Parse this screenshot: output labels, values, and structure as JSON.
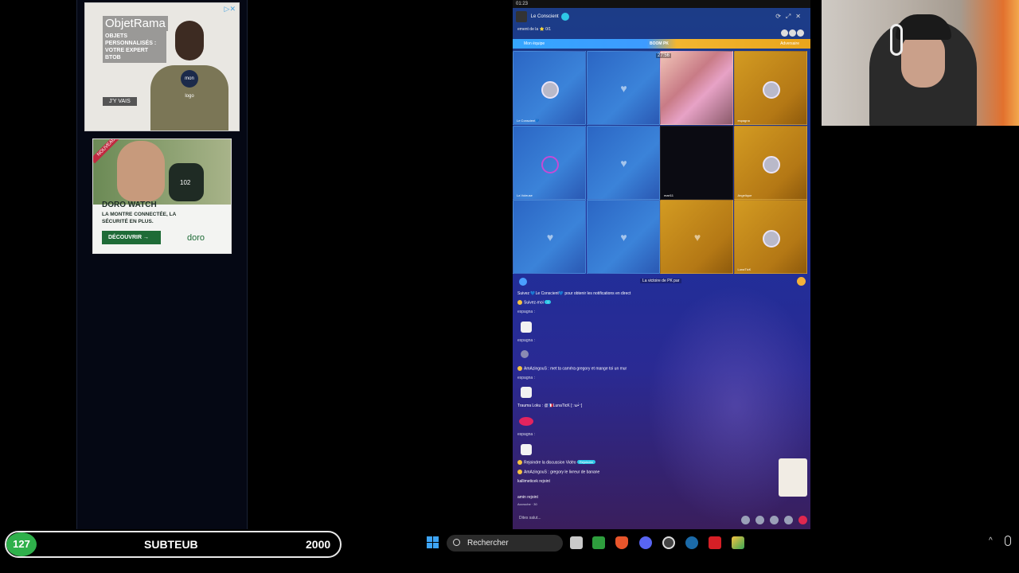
{
  "ads": {
    "objetrama": {
      "brand": "ObjetRama",
      "tagline": "OBJETS PERSONNALISÉS : VOTRE EXPERT BTOB",
      "cta": "J'Y VAIS",
      "logo_text": "mon logo"
    },
    "doro": {
      "badge": "NOUVEAU",
      "watch_value": "102",
      "title": "DORO WATCH",
      "subtitle": "LA MONTRE CONNECTÉE, LA SÉCURITÉ EN PLUS.",
      "cta": "DÉCOUVRIR →",
      "brand": "doro"
    }
  },
  "live": {
    "clock": "01:23",
    "host_name": "Le Conscient",
    "rank_text": "ement de la  ⭐ 0/1",
    "pk_left": "Mon équipe",
    "pk_center": "BOOM PK",
    "pk_right": "Adversaire",
    "timer": "27:56",
    "cells": [
      {
        "type": "blue",
        "kind": "avatar",
        "label": "Le Conscient💙"
      },
      {
        "type": "blue",
        "kind": "heart",
        "label": ""
      },
      {
        "type": "video",
        "kind": "video",
        "label": ""
      },
      {
        "type": "gold",
        "kind": "avatar",
        "label": "espagna"
      },
      {
        "type": "blue",
        "kind": "ring",
        "label": "La Voleuse"
      },
      {
        "type": "blue",
        "kind": "heart",
        "label": ""
      },
      {
        "type": "dark",
        "kind": "dark",
        "label": "mari11"
      },
      {
        "type": "gold",
        "kind": "avatar",
        "label": "Angelique"
      },
      {
        "type": "blue",
        "kind": "heart",
        "label": ""
      },
      {
        "type": "blue",
        "kind": "heart",
        "label": ""
      },
      {
        "type": "gold",
        "kind": "heart",
        "label": ""
      },
      {
        "type": "gold",
        "kind": "avatar",
        "label": "LunaTicK"
      }
    ],
    "pk_victory": "La victoire de PK par",
    "chat": {
      "follow_prompt": "Suivez 💙Le Conscient💙 pour obtenir les notifications en direct",
      "follow_me": "Suivez-moi",
      "user1": "espagna :",
      "user2": "espagna :",
      "msg3": "AmAzingouS : met ta caméra gregory et mange toi un mur",
      "user4": "espagna :",
      "msg5": "Trauma Loku : @🇫🇷LunaTicK [∵ω•̀⁻]",
      "user6": "espagna :",
      "msg7": "Rejoindre la discussion Vidéo",
      "msg7_pill": "Rejoindre",
      "msg8": "AmAzingouS : gregory le livreur de banane",
      "msg9": "kallimeticek rejoint",
      "msg10": "amin rejoint",
      "msg10_sub": "Accroche · 30"
    },
    "input_placeholder": "Dites salut..."
  },
  "subgoal": {
    "count": "127",
    "title": "SUBTEUB",
    "goal": "2000"
  },
  "taskbar": {
    "search_placeholder": "Rechercher",
    "apps": [
      "file-explorer-icon",
      "spreadsheet-icon",
      "brave-icon",
      "discord-icon",
      "streamdeck-icon",
      "steam-icon",
      "youtube-icon",
      "obs-like-icon"
    ]
  }
}
